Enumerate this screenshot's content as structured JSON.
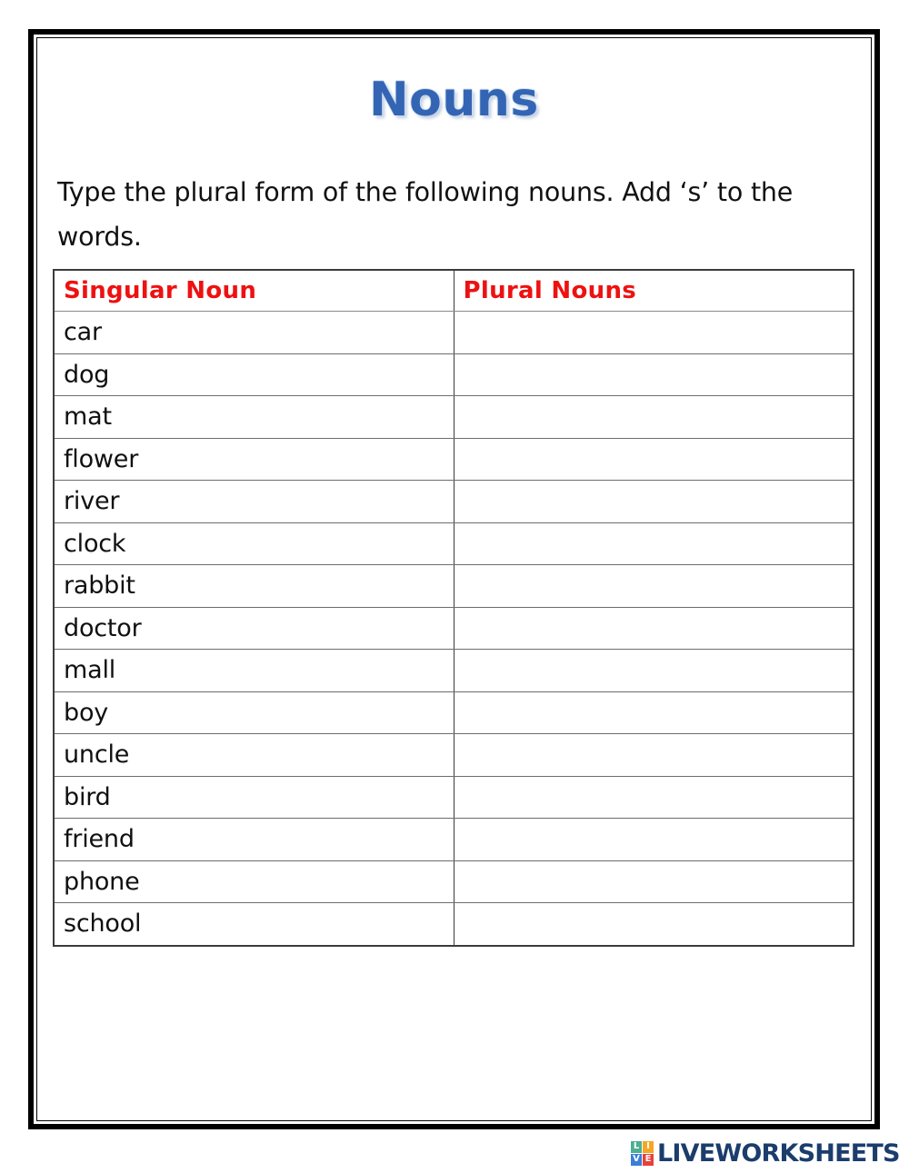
{
  "page": {
    "title": "Nouns",
    "instruction": "Type the plural form of the following nouns. Add ‘s’ to the words.",
    "title_color": "#3465b4",
    "header_color": "#ee1111",
    "border_color": "#000000"
  },
  "table": {
    "columns": [
      "Singular Noun",
      "Plural Nouns"
    ],
    "rows": [
      {
        "singular": "car",
        "plural": ""
      },
      {
        "singular": "dog",
        "plural": ""
      },
      {
        "singular": "mat",
        "plural": ""
      },
      {
        "singular": "flower",
        "plural": ""
      },
      {
        "singular": "river",
        "plural": ""
      },
      {
        "singular": "clock",
        "plural": ""
      },
      {
        "singular": "rabbit",
        "plural": ""
      },
      {
        "singular": "doctor",
        "plural": ""
      },
      {
        "singular": "mall",
        "plural": ""
      },
      {
        "singular": "boy",
        "plural": ""
      },
      {
        "singular": "uncle",
        "plural": ""
      },
      {
        "singular": "bird",
        "plural": ""
      },
      {
        "singular": "friend",
        "plural": ""
      },
      {
        "singular": "phone",
        "plural": ""
      },
      {
        "singular": "school",
        "plural": ""
      }
    ]
  },
  "footer": {
    "logo_tiles": [
      {
        "letter": "L",
        "color": "#4caf8f"
      },
      {
        "letter": "I",
        "color": "#f5a623"
      },
      {
        "letter": "V",
        "color": "#3b7dd8"
      },
      {
        "letter": "E",
        "color": "#e8413c"
      }
    ],
    "wordmark": "LIVEWORKSHEETS",
    "wordmark_color": "#1b3d6d"
  }
}
